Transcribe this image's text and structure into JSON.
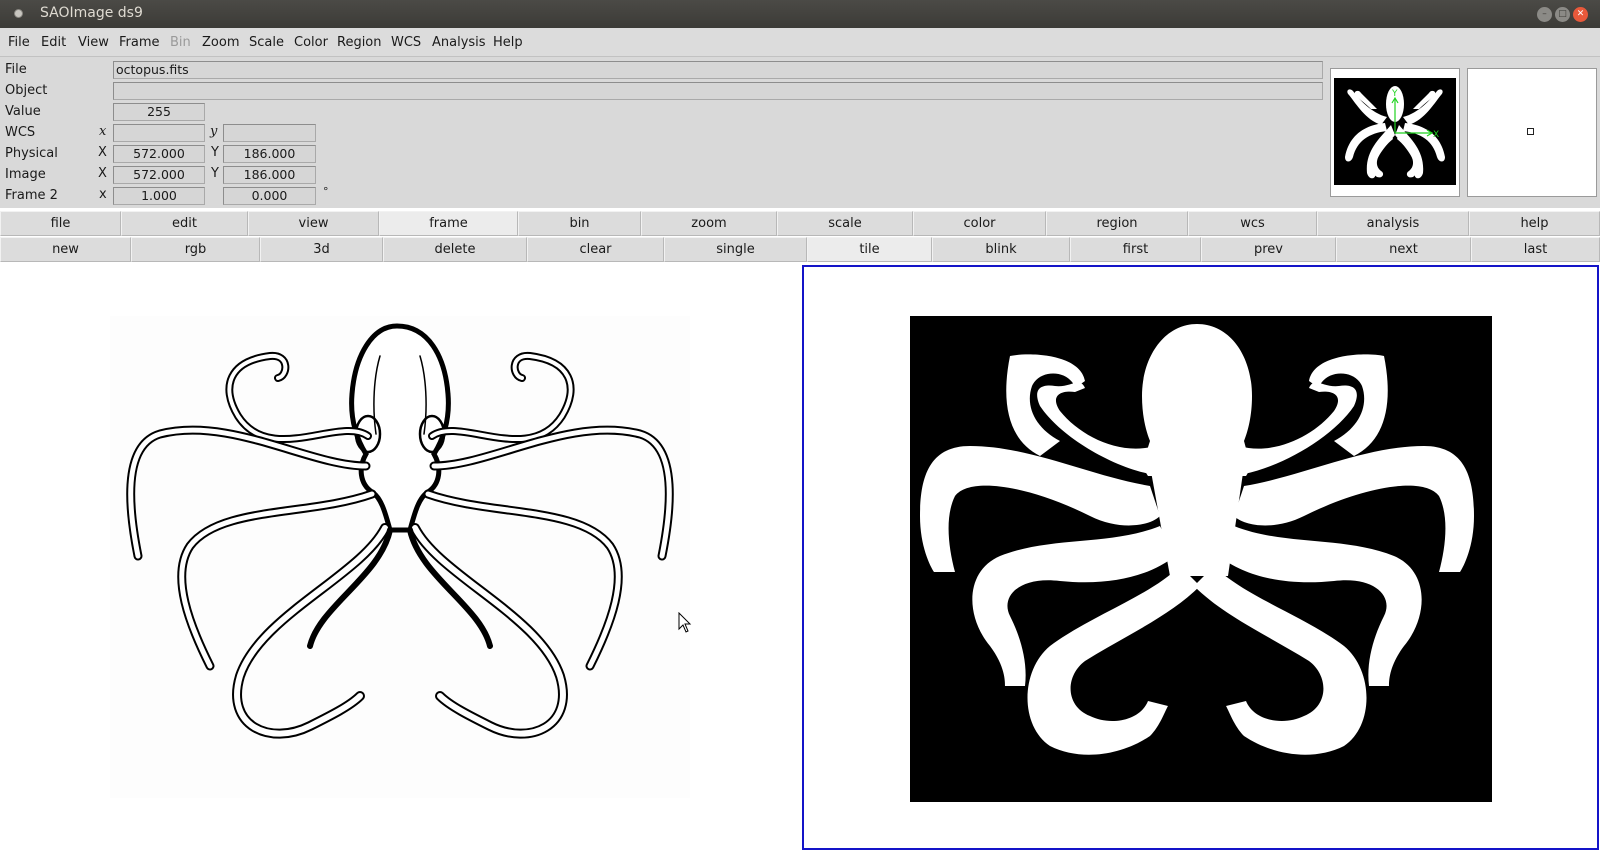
{
  "window": {
    "title": "SAOImage ds9"
  },
  "menu": [
    "File",
    "Edit",
    "View",
    "Frame",
    "Bin",
    "Zoom",
    "Scale",
    "Color",
    "Region",
    "WCS",
    "Analysis",
    "Help"
  ],
  "info": {
    "file_label": "File",
    "file_value": "octopus.fits",
    "object_label": "Object",
    "object_value": "",
    "value_label": "Value",
    "value_value": "255",
    "wcs_label": "WCS",
    "wcs_x_axis": "x",
    "wcs_y_axis": "y",
    "wcs_x": "",
    "wcs_y": "",
    "physical_label": "Physical",
    "physical_x_axis": "X",
    "physical_y_axis": "Y",
    "physical_x": "572.000",
    "physical_y": "186.000",
    "image_label": "Image",
    "image_x_axis": "X",
    "image_y_axis": "Y",
    "image_x": "572.000",
    "image_y": "186.000",
    "frame_label": "Frame 2",
    "frame_axis": "x",
    "frame_zoom": "1.000",
    "frame_angle": "0.000",
    "degree_sign": "°"
  },
  "panner": {
    "y_axis": "Y",
    "x_axis": "X",
    "compass_color": "#1fd21f"
  },
  "buttons_top": [
    {
      "label": "file",
      "active": false
    },
    {
      "label": "edit",
      "active": false
    },
    {
      "label": "view",
      "active": false
    },
    {
      "label": "frame",
      "active": true
    },
    {
      "label": "bin",
      "active": false
    },
    {
      "label": "zoom",
      "active": false
    },
    {
      "label": "scale",
      "active": false
    },
    {
      "label": "color",
      "active": false
    },
    {
      "label": "region",
      "active": false
    },
    {
      "label": "wcs",
      "active": false
    },
    {
      "label": "analysis",
      "active": false
    },
    {
      "label": "help",
      "active": false
    }
  ],
  "buttons_bottom": [
    {
      "label": "new",
      "active": false
    },
    {
      "label": "rgb",
      "active": false
    },
    {
      "label": "3d",
      "active": false
    },
    {
      "label": "delete",
      "active": false
    },
    {
      "label": "clear",
      "active": false
    },
    {
      "label": "single",
      "active": false
    },
    {
      "label": "tile",
      "active": true
    },
    {
      "label": "blink",
      "active": false
    },
    {
      "label": "first",
      "active": false
    },
    {
      "label": "prev",
      "active": false
    },
    {
      "label": "next",
      "active": false
    },
    {
      "label": "last",
      "active": false
    }
  ],
  "colors": {
    "current_frame_border": "#1414c8",
    "titlebar": "#3c3b37",
    "close_button": "#e8593b"
  },
  "icons": [
    "app-icon",
    "minimize-icon",
    "maximize-icon",
    "close-icon",
    "mouse-pointer-icon"
  ]
}
